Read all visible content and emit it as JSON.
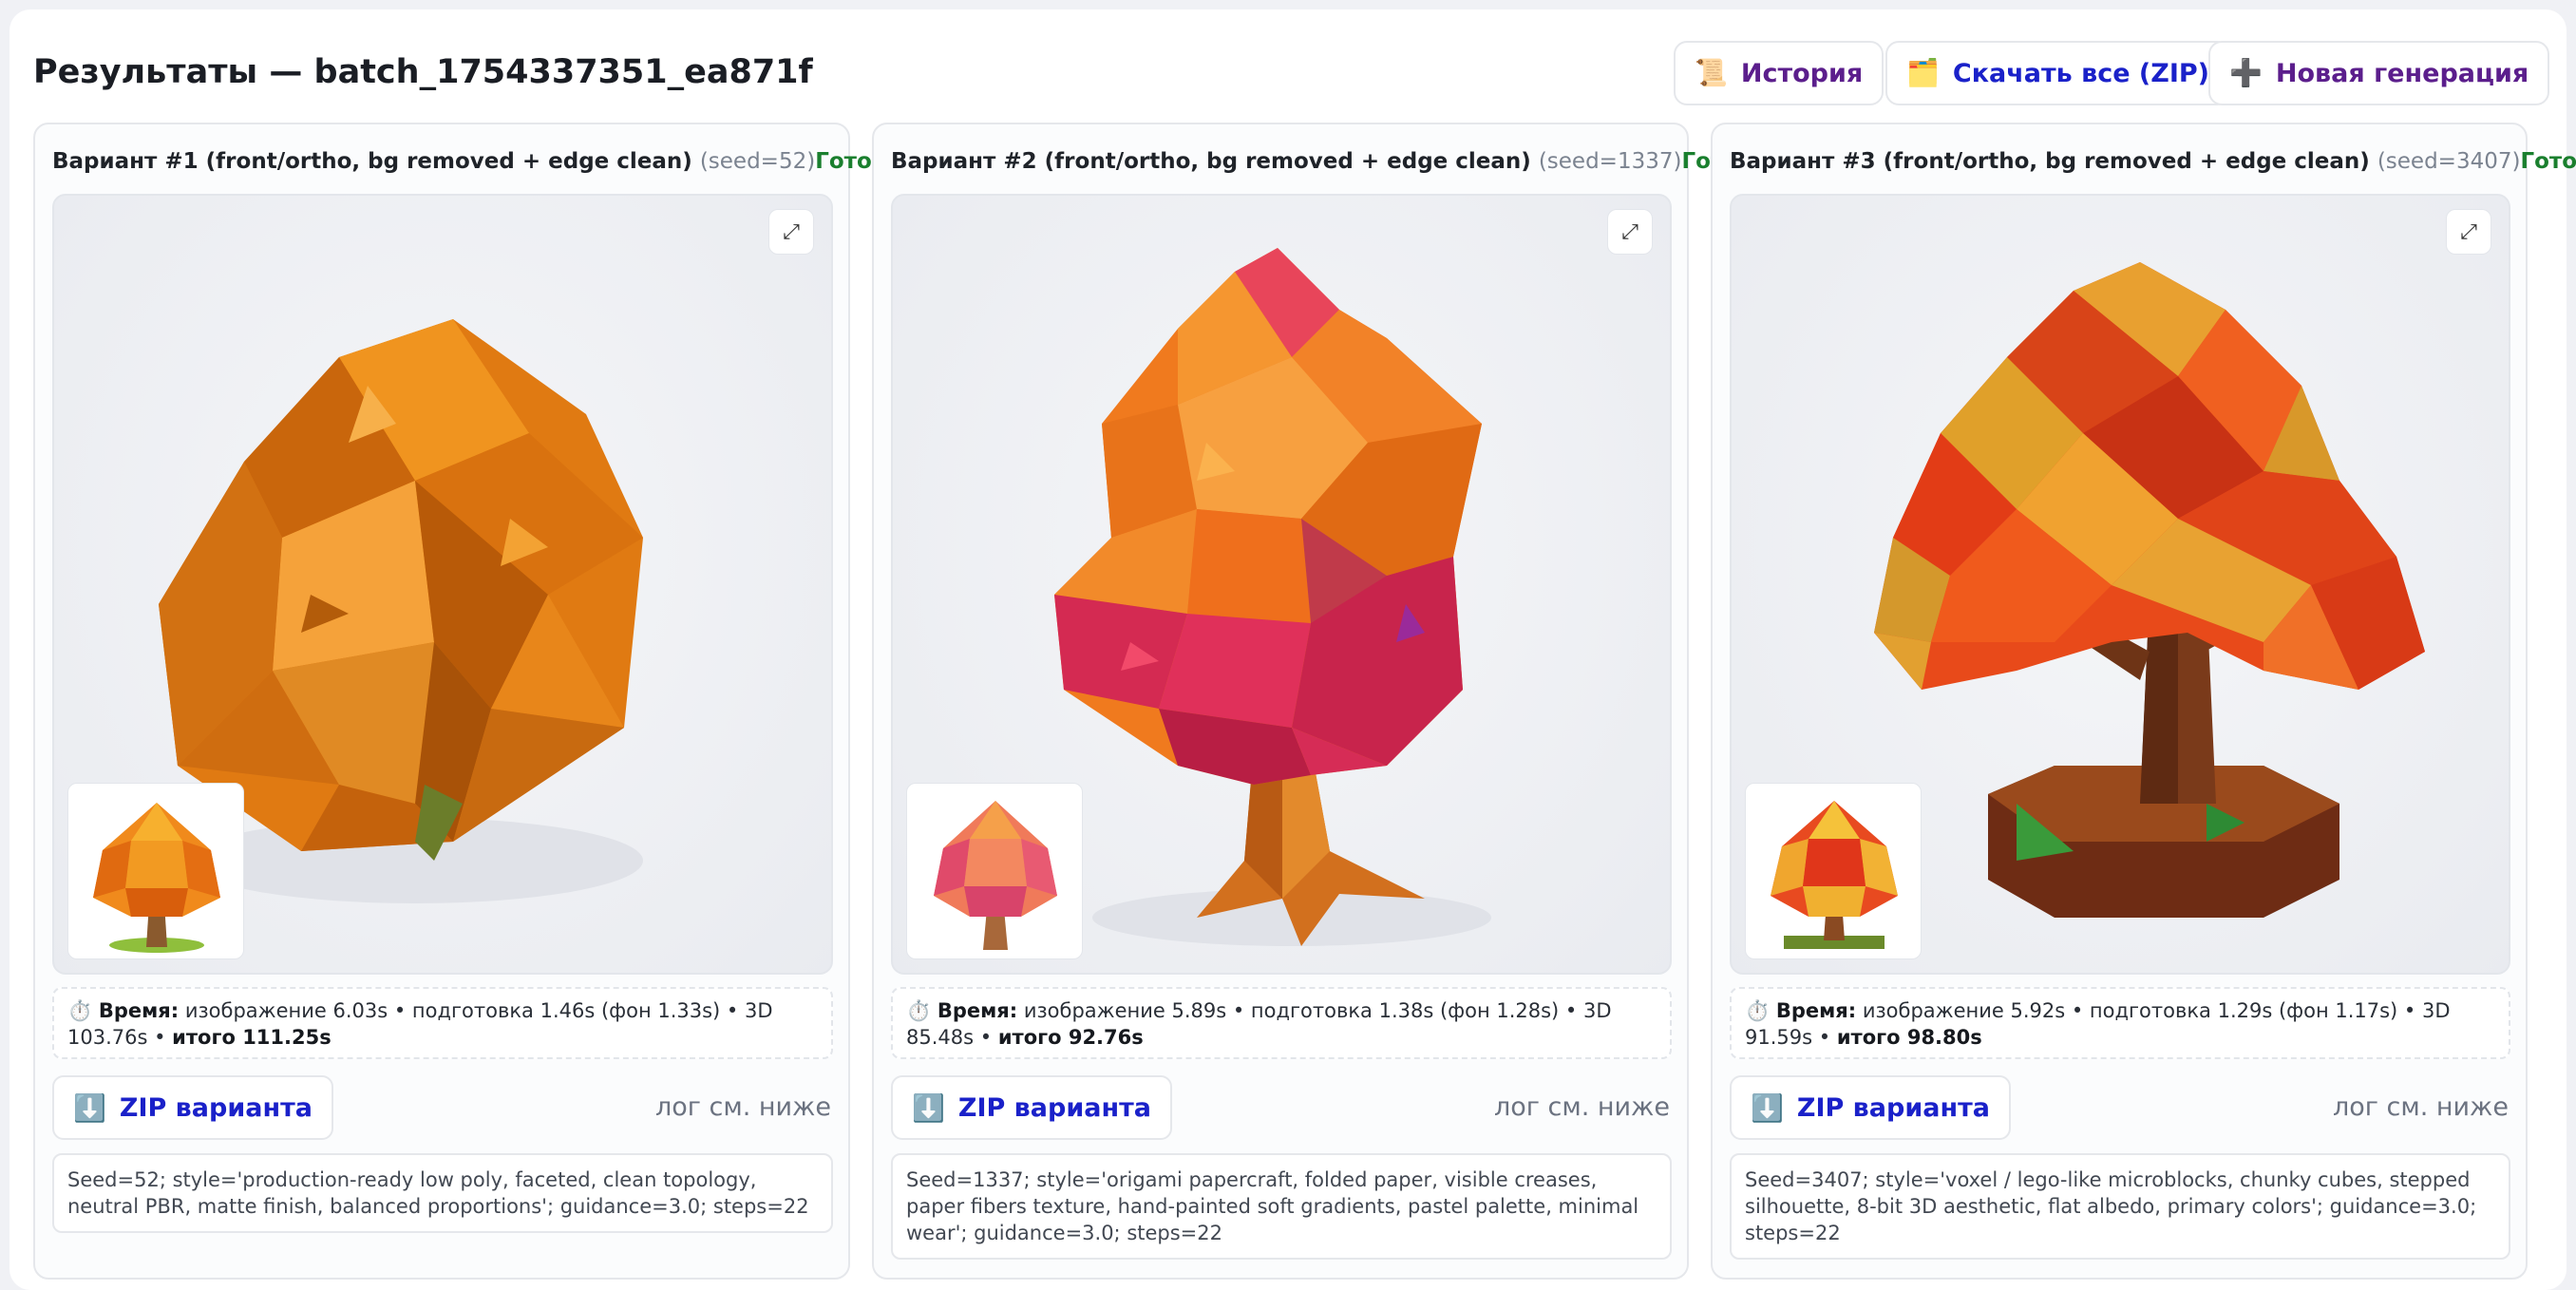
{
  "header": {
    "title": "Результаты — batch_1754337351_ea871f",
    "buttons": [
      {
        "icon": "📜",
        "label": "История"
      },
      {
        "icon": "🗂️",
        "label": "Скачать все (ZIP)"
      },
      {
        "icon": "➕",
        "label": "Новая генерация"
      }
    ]
  },
  "variants": [
    {
      "title": "Вариант #1 (front/ortho, bg removed + edge clean)",
      "seed_tag": "(seed=52)",
      "status": "Готово",
      "status_color": "#1a7f2e",
      "expand_icon": "⤢",
      "timing_icon": "⏱️",
      "timing_label": "Время:",
      "timing_text": "изображение 6.03s • подготовка 1.46s (фон 1.33s) • 3D 103.76s •",
      "timing_total": "итого 111.25s",
      "zip_icon": "⬇️",
      "zip_label": "ZIP варианта",
      "log_hint": "лог см. ниже",
      "description": "Seed=52; style='production-ready low poly, faceted, clean topology, neutral PBR, matte finish, balanced proportions'; guidance=3.0; steps=22"
    },
    {
      "title": "Вариант #2 (front/ortho, bg removed + edge clean)",
      "seed_tag": "(seed=1337)",
      "status": "Готово",
      "status_color": "#1a7f2e",
      "expand_icon": "⤢",
      "timing_icon": "⏱️",
      "timing_label": "Время:",
      "timing_text": "изображение 5.89s • подготовка 1.38s (фон 1.28s) • 3D 85.48s •",
      "timing_total": "итого 92.76s",
      "zip_icon": "⬇️",
      "zip_label": "ZIP варианта",
      "log_hint": "лог см. ниже",
      "description": "Seed=1337; style='origami papercraft, folded paper, visible creases, paper fibers texture, hand-painted soft gradients, pastel palette, minimal wear'; guidance=3.0; steps=22"
    },
    {
      "title": "Вариант #3 (front/ortho, bg removed + edge clean)",
      "seed_tag": "(seed=3407)",
      "status": "Готово",
      "status_color": "#1a7f2e",
      "expand_icon": "⤢",
      "timing_icon": "⏱️",
      "timing_label": "Время:",
      "timing_text": "изображение 5.92s • подготовка 1.29s (фон 1.17s) • 3D 91.59s •",
      "timing_total": "итого 98.80s",
      "zip_icon": "⬇️",
      "zip_label": "ZIP варианта",
      "log_hint": "лог см. ниже",
      "description": "Seed=3407; style='voxel / lego-like microblocks, chunky cubes, stepped silhouette, 8-bit 3D aesthetic, flat albedo, primary colors'; guidance=3.0; steps=22"
    }
  ]
}
